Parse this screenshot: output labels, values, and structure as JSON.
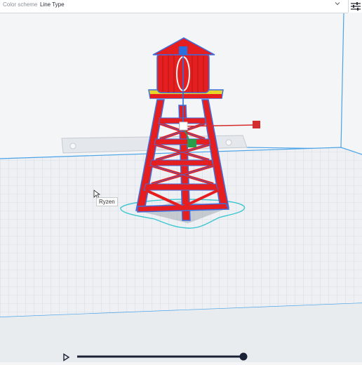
{
  "toolbar": {
    "color_scheme_label": "Color scheme",
    "color_scheme_value": "Line Type",
    "dropdown_icon": "chevron-down-icon",
    "settings_icon": "sliders-icon"
  },
  "viewport": {
    "cursor_tooltip": "Ryzen",
    "model_name": "water-tower",
    "colors": {
      "build_plate": "#eef0f3",
      "grid_line": "#cfd6df",
      "volume_edge": "#4aa3e8",
      "model_wall": "#e51f1f",
      "model_outline": "#3d6fe0",
      "model_infill": "#e8d52a",
      "skirt": "#3cc7d0",
      "gizmo_x": "#d42c2c",
      "gizmo_y": "#2a9d4a",
      "gizmo_z": "#2a6fe0"
    }
  },
  "layer_slider": {
    "play_icon": "play-icon",
    "progress": 1.0,
    "track_color": "#1a2236"
  }
}
